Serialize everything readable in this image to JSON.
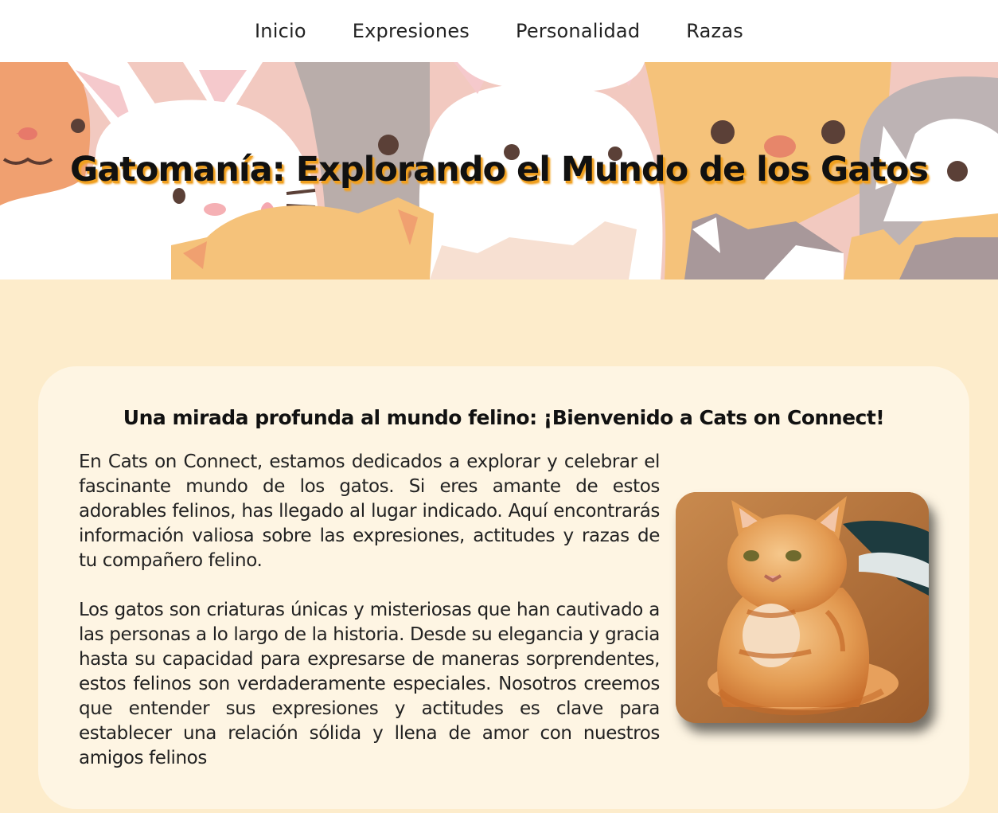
{
  "nav": {
    "items": [
      {
        "label": "Inicio"
      },
      {
        "label": "Expresiones"
      },
      {
        "label": "Personalidad"
      },
      {
        "label": "Razas"
      }
    ]
  },
  "hero": {
    "title": "Gatomanía: Explorando el Mundo de los Gatos"
  },
  "welcome": {
    "heading": "Una mirada profunda al mundo felino: ¡Bienvenido a Cats on Connect!",
    "paragraphs": [
      "En Cats on Connect, estamos dedicados a explorar y celebrar el fascinante mundo de los gatos. Si eres amante de estos adorables felinos, has llegado al lugar indicado. Aquí encontrarás información valiosa sobre las expresiones, actitudes y razas de tu compañero felino.",
      "Los gatos son criaturas únicas y misteriosas que han cautivado a las personas a lo largo de la historia. Desde su elegancia y gracia hasta su capacidad para expresarse de maneras sorprendentes, estos felinos son verdaderamente especiales. Nosotros creemos que entender sus expresiones y actitudes es clave para establecer una relación sólida y llena de amor con nuestros amigos felinos"
    ]
  },
  "colors": {
    "page_background": "#fdeccb",
    "card_background": "#fef5e3",
    "title_shadow": "#f0a020"
  }
}
